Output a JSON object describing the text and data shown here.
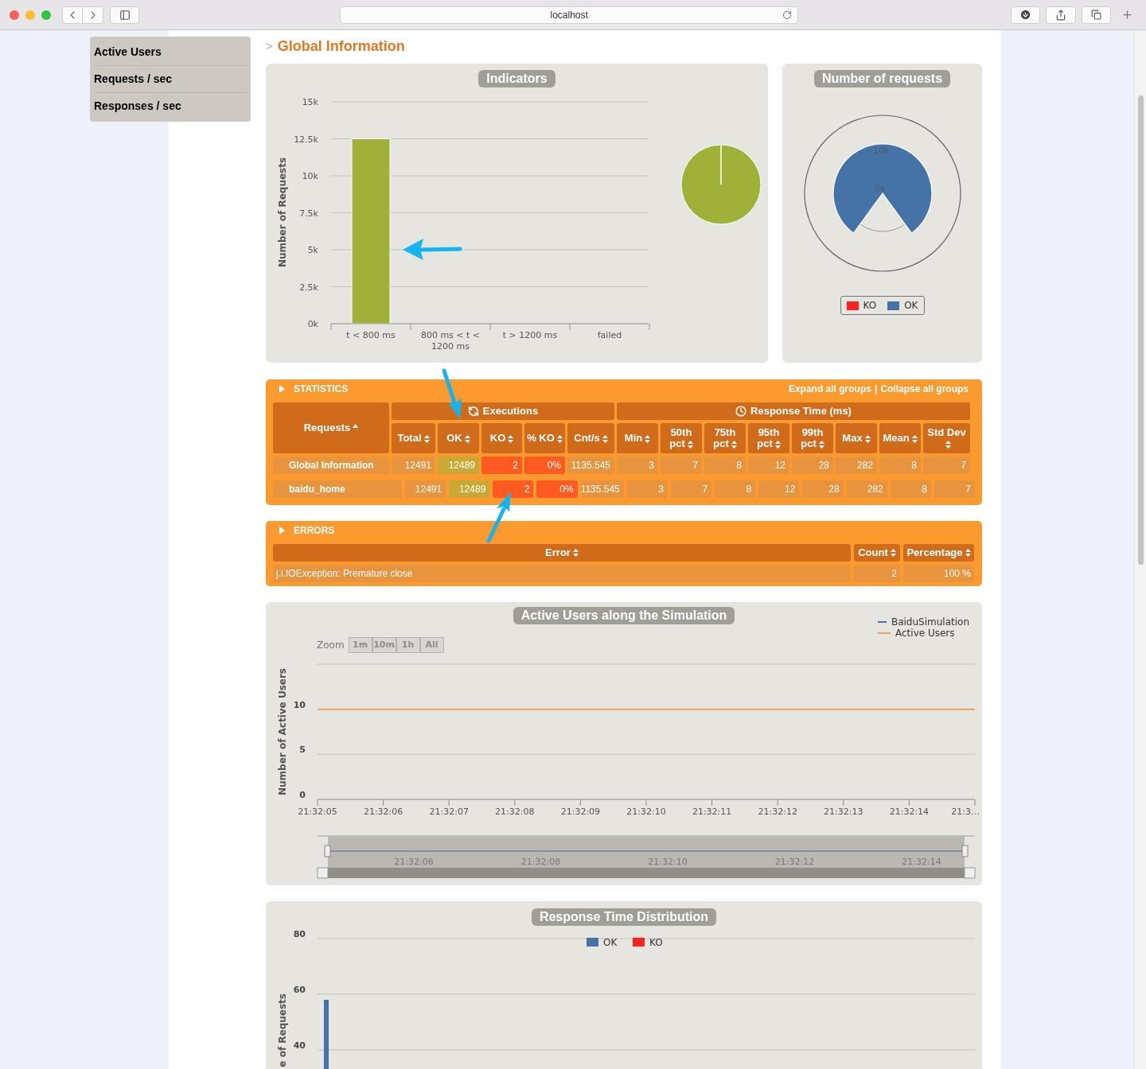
{
  "browser": {
    "address": "localhost"
  },
  "sidebar": {
    "items": [
      {
        "label": "Active Users"
      },
      {
        "label": "Requests / sec"
      },
      {
        "label": "Responses / sec"
      }
    ]
  },
  "page_title": {
    "marker": ">",
    "text": "Global Information"
  },
  "indicators": {
    "title": "Indicators",
    "chart_data": {
      "type": "bar",
      "ylabel": "Number of Requests",
      "grid": true,
      "categories": [
        "t < 800 ms",
        "800 ms < t < 1200 ms",
        "t > 1200 ms",
        "failed"
      ],
      "series": [
        {
          "color": "#a0b13a",
          "values": [
            12500,
            0,
            0,
            0
          ]
        }
      ],
      "ylim": [
        0,
        15000
      ],
      "yticks": [
        {
          "value": 0,
          "label": "0k"
        },
        {
          "value": 2500,
          "label": "2.5k"
        },
        {
          "value": 5000,
          "label": "5k"
        },
        {
          "value": 7500,
          "label": "7.5k"
        },
        {
          "value": 10000,
          "label": "10k"
        },
        {
          "value": 12500,
          "label": "12.5k"
        },
        {
          "value": 15000,
          "label": "15k"
        }
      ]
    }
  },
  "requests_pie": {
    "title": "Number of requests",
    "scale_labels": [
      "10k",
      "0k"
    ],
    "legend": [
      {
        "label": "KO",
        "color": "#ff2020"
      },
      {
        "label": "OK",
        "color": "#4572a7"
      }
    ]
  },
  "statistics": {
    "title": "STATISTICS",
    "expand_link": "Expand all groups",
    "separator": "|",
    "collapse_link": "Collapse all groups",
    "requests_header": {
      "label": "Requests",
      "sorted": true
    },
    "groups": [
      {
        "label": "Executions",
        "columns": [
          {
            "label": "Total",
            "sorted": false,
            "kind": "plain"
          },
          {
            "label": "OK",
            "sorted": false,
            "kind": "ok"
          },
          {
            "label": "KO",
            "sorted": false,
            "kind": "ko"
          },
          {
            "label": "% KO",
            "sorted": false,
            "kind": "ko"
          },
          {
            "label": "Cnt/s",
            "sorted": false,
            "kind": "plain"
          }
        ]
      },
      {
        "label": "Response Time (ms)",
        "columns": [
          {
            "label": "Min",
            "sorted": false,
            "kind": "plain"
          },
          {
            "label": "50th pct",
            "sorted": false,
            "kind": "plain"
          },
          {
            "label": "75th pct",
            "sorted": false,
            "kind": "plain"
          },
          {
            "label": "95th pct",
            "sorted": false,
            "kind": "plain"
          },
          {
            "label": "99th pct",
            "sorted": false,
            "kind": "plain"
          },
          {
            "label": "Max",
            "sorted": false,
            "kind": "plain"
          },
          {
            "label": "Mean",
            "sorted": false,
            "kind": "plain"
          },
          {
            "label": "Std Dev",
            "sorted": false,
            "kind": "plain"
          }
        ]
      }
    ],
    "rows": [
      {
        "name": "Global Information",
        "values": [
          "12491",
          "12489",
          "2",
          "0%",
          "1135.545",
          "3",
          "7",
          "8",
          "12",
          "28",
          "282",
          "8",
          "7"
        ],
        "children": [
          {
            "name": "baidu_home",
            "values": [
              "12491",
              "12489",
              "2",
              "0%",
              "1135.545",
              "3",
              "7",
              "8",
              "12",
              "28",
              "282",
              "8",
              "7"
            ]
          }
        ]
      }
    ]
  },
  "errors": {
    "title": "ERRORS",
    "columns": [
      {
        "label": "Error",
        "sorted": false
      },
      {
        "label": "Count",
        "sorted": false
      },
      {
        "label": "Percentage",
        "sorted": false
      }
    ],
    "rows": [
      {
        "cells": [
          "j.i.IOException: Premature close",
          "2",
          "100 %"
        ]
      }
    ]
  },
  "active_users": {
    "title": "Active Users along the Simulation",
    "legend": [
      {
        "label": "BaiduSimulation",
        "color": "#4572a7"
      },
      {
        "label": "Active Users",
        "color": "#f0a050"
      }
    ],
    "zoom_label": "Zoom",
    "zoom_buttons": [
      {
        "label": "1m",
        "disabled": true
      },
      {
        "label": "10m",
        "disabled": true
      },
      {
        "label": "1h",
        "disabled": true
      },
      {
        "label": "All",
        "disabled": true
      }
    ],
    "chart_data": {
      "type": "line",
      "ylabel": "Number of Active Users",
      "grid": true,
      "categories": [
        "21:32:05",
        "21:32:06",
        "21:32:07",
        "21:32:08",
        "21:32:09",
        "21:32:10",
        "21:32:11",
        "21:32:12",
        "21:32:13",
        "21:32:14",
        "21:3…"
      ],
      "series": [
        {
          "color": "#f0a050",
          "values": [
            10,
            10,
            10,
            10,
            10,
            10,
            10,
            10,
            10,
            10,
            10
          ]
        }
      ],
      "ylim": [
        0,
        15
      ],
      "yticks": [
        0,
        5,
        10
      ]
    },
    "navigator_labels": [
      "21:32:06",
      "21:32:08",
      "21:32:10",
      "21:32:12",
      "21:32:14"
    ]
  },
  "distribution": {
    "title": "Response Time Distribution",
    "chart_data": {
      "type": "bar",
      "ylabel": "e of Requests",
      "grid": true,
      "series": [
        {
          "name": "OK",
          "color": "#4572a7",
          "values": [
            58
          ]
        },
        {
          "name": "KO",
          "color": "#ff2020",
          "values": [
            0
          ]
        }
      ],
      "ylim": [
        0,
        80
      ],
      "yticks": [
        40,
        60,
        80
      ]
    }
  }
}
